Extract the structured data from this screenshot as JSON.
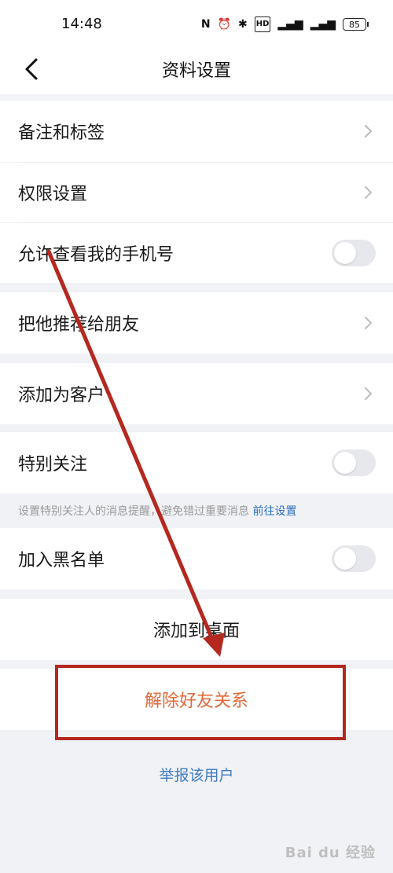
{
  "status_bar": {
    "time": "14:48",
    "icons": [
      "nfc-icon",
      "alarm-icon",
      "bluetooth-icon",
      "hd-icon",
      "5g-signal-icon",
      "4g-signal-icon"
    ],
    "battery": "85"
  },
  "nav": {
    "title": "资料设置"
  },
  "settings": {
    "remark_tags": "备注和标签",
    "permissions": "权限设置",
    "allow_view_phone": "允许查看我的手机号",
    "recommend_to_friend": "把他推荐给朋友",
    "add_as_customer": "添加为客户",
    "special_follow": "特别关注",
    "special_follow_hint": "设置特别关注人的消息提醒，避免错过重要消息",
    "special_follow_hint_link": "前往设置",
    "add_to_blacklist": "加入黑名单",
    "add_to_desktop": "添加到桌面",
    "remove_friend": "解除好友关系",
    "report_user": "举报该用户"
  },
  "toggles": {
    "allow_view_phone": false,
    "special_follow": false,
    "add_to_blacklist": false
  },
  "watermark": "Bai du 经验",
  "colors": {
    "accent_link": "#2a6fbd",
    "danger_text": "#e0693a",
    "annotation_red": "#b5281f"
  }
}
